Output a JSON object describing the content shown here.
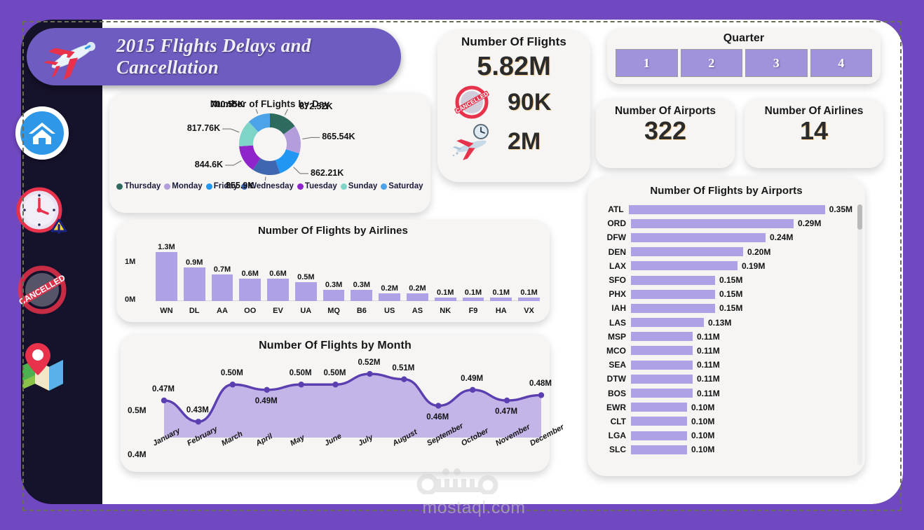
{
  "header": {
    "title": "2015 Flights Delays and Cancellation",
    "plane_icon": "airplane-icon"
  },
  "sidebar": {
    "items": [
      {
        "name": "home",
        "icon": "home-icon",
        "active": true
      },
      {
        "name": "delays",
        "icon": "clock-warning-icon",
        "active": false
      },
      {
        "name": "cancelled",
        "icon": "cancelled-stamp-icon",
        "active": false
      },
      {
        "name": "map",
        "icon": "map-pin-icon",
        "active": false
      }
    ]
  },
  "kpi_flights": {
    "title": "Number Of Flights",
    "total": "5.82M",
    "cancelled": "90K",
    "cancelled_icon": "cancelled-stamp-icon",
    "delayed": "2M",
    "delayed_icon": "delayed-plane-clock-icon"
  },
  "quarter": {
    "title": "Quarter",
    "options": [
      "1",
      "2",
      "3",
      "4"
    ]
  },
  "kpi_airports": {
    "title": "Number Of Airports",
    "value": "322"
  },
  "kpi_airlines": {
    "title": "Number Of Airlines",
    "value": "14"
  },
  "watermark": {
    "text": "mostaql.com",
    "logo": "mostaql-logo-icon"
  },
  "colors": {
    "background": "#7048bf",
    "device": "#15122b",
    "sheet": "#ffffff",
    "card": "#f6f5f4",
    "accent_purple": "#6e5cc0",
    "bar_purple": "#b0a0e5",
    "line_stroke": "#5b3fb0",
    "line_fill": "#c4b5e8",
    "slicer": "#a192dc",
    "home_blue": "#2e97e8"
  },
  "chart_data": [
    {
      "id": "flights_by_day",
      "type": "pie",
      "title": "Number of FLights by Day",
      "legend_position": "bottom",
      "categories": [
        "Thursday",
        "Monday",
        "Friday",
        "Wednesday",
        "Tuesday",
        "Sunday",
        "Saturday"
      ],
      "values": [
        872520,
        865540,
        862210,
        855900,
        844600,
        817760,
        700550
      ],
      "labels": [
        "872.52K",
        "865.54K",
        "862.21K",
        "855.9K",
        "844.6K",
        "817.76K",
        "700.55K"
      ],
      "colors": [
        "#2e6b5e",
        "#b39ddb",
        "#2196f3",
        "#3f66b0",
        "#8e24c9",
        "#7fd4c8",
        "#4da3e8"
      ]
    },
    {
      "id": "flights_by_airlines",
      "type": "bar",
      "title": "Number  Of Flights by Airlines",
      "xlabel": "",
      "ylabel": "",
      "ylim": [
        0,
        1300000
      ],
      "ytick_labels": [
        "1M",
        "0M"
      ],
      "grid": false,
      "categories": [
        "WN",
        "DL",
        "AA",
        "OO",
        "EV",
        "UA",
        "MQ",
        "B6",
        "US",
        "AS",
        "NK",
        "F9",
        "HA",
        "VX"
      ],
      "values": [
        1.3,
        0.9,
        0.7,
        0.6,
        0.6,
        0.5,
        0.3,
        0.3,
        0.2,
        0.2,
        0.1,
        0.1,
        0.1,
        0.1
      ],
      "labels": [
        "1.3M",
        "0.9M",
        "0.7M",
        "0.6M",
        "0.6M",
        "0.5M",
        "0.3M",
        "0.3M",
        "0.2M",
        "0.2M",
        "0.1M",
        "0.1M",
        "0.1M",
        "0.1M"
      ]
    },
    {
      "id": "flights_by_month",
      "type": "area",
      "title": "Number Of Flights by Month",
      "xlabel": "",
      "ylabel": "",
      "ylim": [
        0.4,
        0.53
      ],
      "ytick_labels": [
        "0.5M",
        "0.4M"
      ],
      "grid": false,
      "categories": [
        "January",
        "February",
        "March",
        "April",
        "May",
        "June",
        "July",
        "August",
        "September",
        "October",
        "November",
        "December"
      ],
      "values": [
        0.47,
        0.43,
        0.5,
        0.49,
        0.5,
        0.5,
        0.52,
        0.51,
        0.46,
        0.49,
        0.47,
        0.48
      ],
      "labels": [
        "0.47M",
        "0.43M",
        "0.50M",
        "0.49M",
        "0.50M",
        "0.50M",
        "0.52M",
        "0.51M",
        "0.46M",
        "0.49M",
        "0.47M",
        "0.48M"
      ]
    },
    {
      "id": "flights_by_airports",
      "type": "bar",
      "orientation": "horizontal",
      "title": "Number  Of Flights by Airports",
      "scrollable": true,
      "categories": [
        "ATL",
        "ORD",
        "DFW",
        "DEN",
        "LAX",
        "SFO",
        "PHX",
        "IAH",
        "LAS",
        "MSP",
        "MCO",
        "SEA",
        "DTW",
        "BOS",
        "EWR",
        "CLT",
        "LGA",
        "SLC"
      ],
      "values": [
        0.35,
        0.29,
        0.24,
        0.2,
        0.19,
        0.15,
        0.15,
        0.15,
        0.13,
        0.11,
        0.11,
        0.11,
        0.11,
        0.11,
        0.1,
        0.1,
        0.1,
        0.1
      ],
      "labels": [
        "0.35M",
        "0.29M",
        "0.24M",
        "0.20M",
        "0.19M",
        "0.15M",
        "0.15M",
        "0.15M",
        "0.13M",
        "0.11M",
        "0.11M",
        "0.11M",
        "0.11M",
        "0.11M",
        "0.10M",
        "0.10M",
        "0.10M",
        "0.10M"
      ]
    }
  ]
}
